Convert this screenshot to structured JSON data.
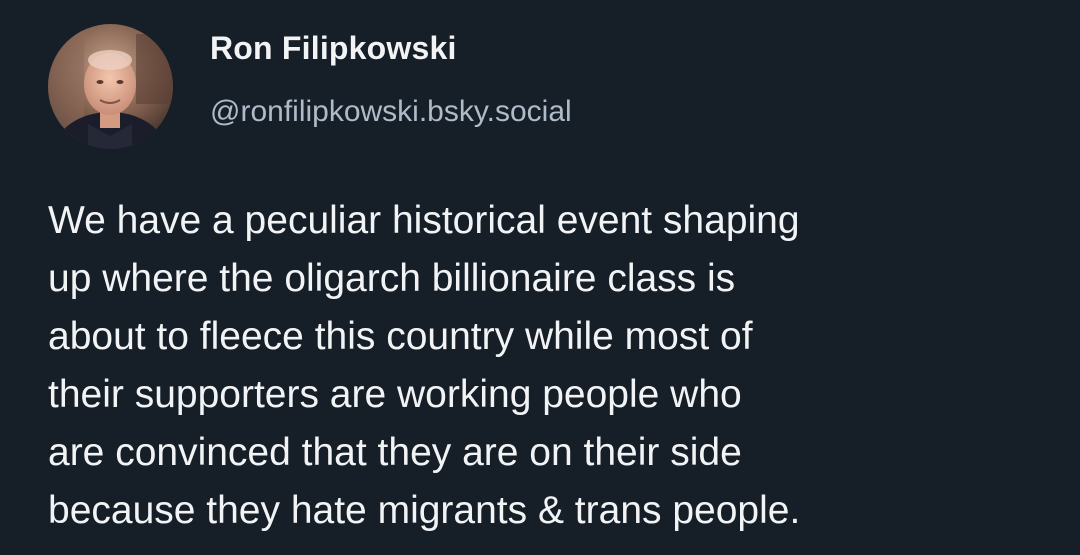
{
  "post": {
    "author": {
      "display_name": "Ron Filipkowski",
      "handle": "@ronfilipkowski.bsky.social"
    },
    "text_lines": [
      "We have a peculiar historical event shaping",
      "up where the oligarch billionaire class is",
      "about to fleece this country while most of",
      "their supporters are working people who",
      "are convinced that they are on their side",
      "because they hate migrants & trans people."
    ]
  },
  "colors": {
    "background": "#161e27",
    "text": "#f1f3f5",
    "handle": "#aebbc9"
  },
  "icons": {
    "avatar": "author-avatar-photo"
  }
}
